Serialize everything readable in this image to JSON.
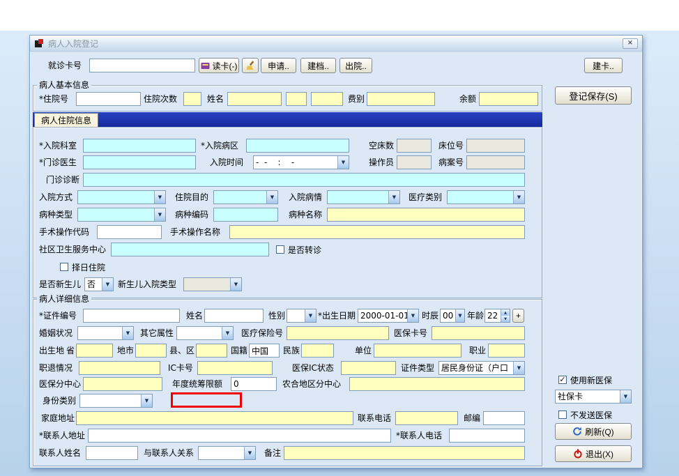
{
  "colors": {
    "required_bg": "#ffffff",
    "auto_bg": "#ffffc0",
    "focus_bg": "#c9ffff",
    "readonly_bg": "#e9e9e0",
    "tabstrip_bg": "#1c35b0",
    "highlight": "#f20000"
  },
  "window": {
    "title": "病人入院登记"
  },
  "toolbar": {
    "visit_card_label": "就诊卡号",
    "read_card": "读卡(-)",
    "apply": "申请..",
    "archive": "建档..",
    "discharge": "出院..",
    "create_card": "建卡.."
  },
  "basic": {
    "title": "病人基本信息",
    "inpatient_no": "*住院号",
    "admit_count": "住院次数",
    "name": "姓名",
    "fee_type": "费别",
    "balance": "余额"
  },
  "tab": {
    "hosp_info": "病人住院信息"
  },
  "hosp": {
    "dept": "*入院科室",
    "ward": "*入院病区",
    "empty_beds": "空床数",
    "bed_no": "床位号",
    "doctor": "*门诊医生",
    "admit_time": "入院时间",
    "admit_time_value": "-  -    :    -",
    "operator": "操作员",
    "case_no": "病案号",
    "diagnosis": "门诊诊断",
    "admit_way": "入院方式",
    "purpose": "住院目的",
    "condition": "入院病情",
    "med_category": "医疗类别",
    "disease_type": "病种类型",
    "disease_code": "病种编码",
    "disease_name": "病种名称",
    "op_code": "手术操作代码",
    "op_name": "手术操作名称",
    "community": "社区卫生服务中心",
    "is_transfer": "是否转诊",
    "scheduled": "择日住院",
    "newborn": "是否新生儿",
    "newborn_value": "否",
    "newborn_type": "新生儿入院类型"
  },
  "detail": {
    "title": "病人详细信息",
    "id_no": "*证件编号",
    "name": "姓名",
    "gender": "性别",
    "birth_date": "*出生日期",
    "birth_date_value": "2000-01-01",
    "hour": "时辰",
    "hour_value": "00",
    "age": "年龄",
    "age_value": "22",
    "plus": "+",
    "marriage": "婚姻状况",
    "other_attr": "其它属性",
    "insurance_no": "医疗保险号",
    "insurance_card": "医保卡号",
    "birthplace": "出生地",
    "province": "省",
    "city": "地市",
    "county": "县、区",
    "nationality": "国籍",
    "nationality_value": "中国",
    "ethnic": "民族",
    "employer": "单位",
    "occupation": "职业",
    "employment": "职退情况",
    "ic_card": "IC卡号",
    "ins_ic_status": "医保IC状态",
    "id_type": "证件类型",
    "id_type_value": "居民身份证（户口",
    "ins_center": "医保分中心",
    "annual_limit": "年度统筹限额",
    "annual_limit_value": "0",
    "rural_center": "农合地区分中心",
    "identity_cat": "身份类别",
    "home_addr": "家庭地址",
    "phone": "联系电话",
    "zip": "邮编",
    "contact_addr": "*联系人地址",
    "contact_phone": "*联系人电话",
    "contact_name": "联系人姓名",
    "contact_rel": "与联系人关系",
    "remark": "备注"
  },
  "side": {
    "save": "登记保存(S)",
    "use_new_insurance": "使用新医保",
    "card_type_value": "社保卡",
    "no_send_insurance": "不发送医保",
    "refresh": "刷新(Q)",
    "exit": "退出(X)"
  }
}
